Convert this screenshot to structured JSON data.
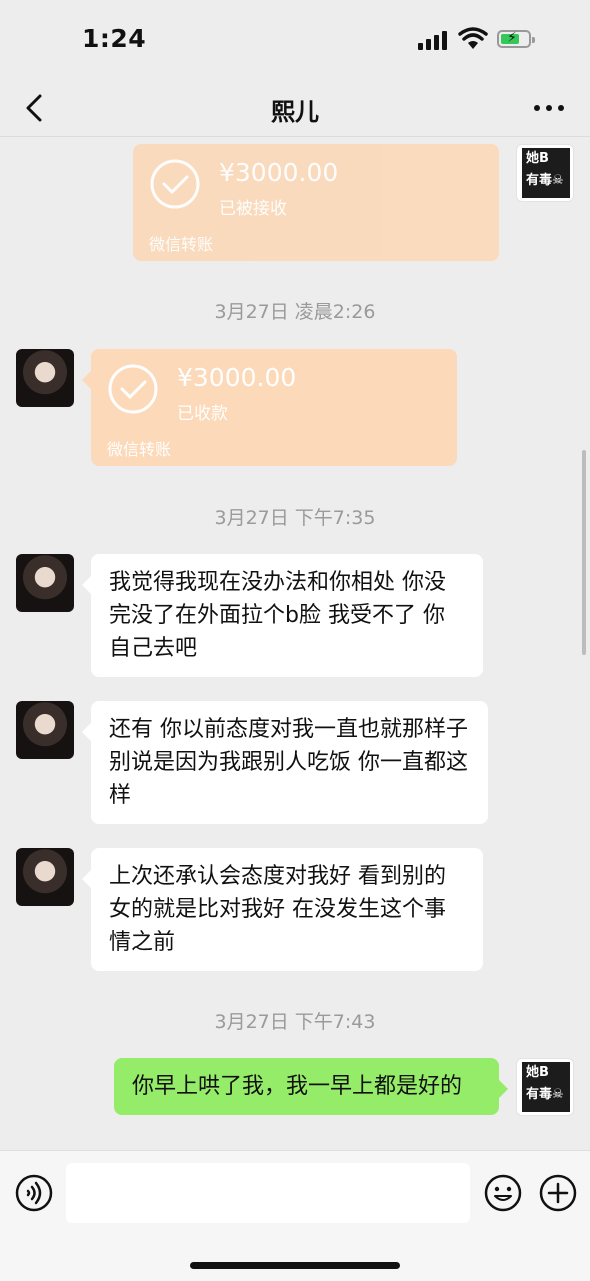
{
  "status_bar": {
    "time": "1:24"
  },
  "nav": {
    "title": "熙儿"
  },
  "avatars": {
    "me_line1": "她B",
    "me_line2": "有毒☠"
  },
  "messages": {
    "transfer_1": {
      "amount": "¥3000.00",
      "status": "已被接收",
      "footer": "微信转账"
    },
    "ts_1": "3月27日 凌晨2:26",
    "transfer_2": {
      "amount": "¥3000.00",
      "status": "已收款",
      "footer": "微信转账"
    },
    "ts_2": "3月27日 下午7:35",
    "msg_1": "我觉得我现在没办法和你相处 你没完没了在外面拉个b脸 我受不了 你自己去吧",
    "msg_2": "还有 你以前态度对我一直也就那样子 别说是因为我跟别人吃饭 你一直都这样",
    "msg_3": "上次还承认会态度对我好 看到别的女的就是比对我好 在没发生这个事情之前",
    "ts_3": "3月27日 下午7:43",
    "msg_4": "你早上哄了我，我一早上都是好的"
  },
  "input": {
    "placeholder": ""
  },
  "colors": {
    "bubble_me": "#95ec69",
    "bubble_other": "#ffffff",
    "transfer": "#fcd9b8",
    "background": "#ededed"
  },
  "icons": [
    "back-icon",
    "more-icon",
    "check-icon",
    "voice-icon",
    "emoji-icon",
    "plus-icon"
  ]
}
